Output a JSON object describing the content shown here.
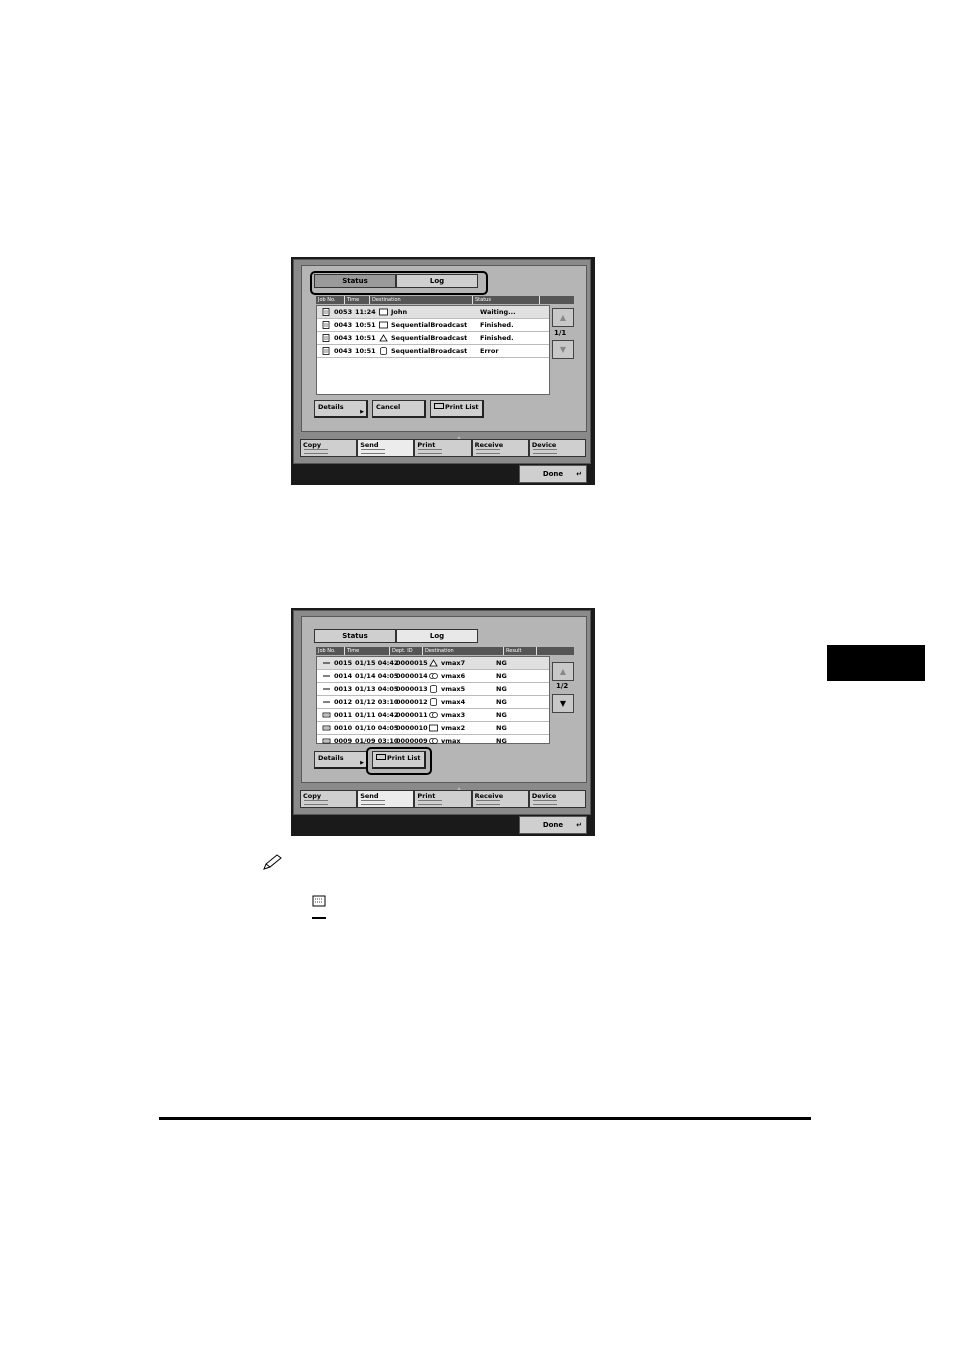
{
  "screen1": {
    "tabs": [
      "Status",
      "Log"
    ],
    "columns": [
      "Job No.",
      "Time",
      "Destination",
      "Status"
    ],
    "rows": [
      {
        "job": "0053",
        "time": "11:24",
        "dest_icon": "pc-icon",
        "dest": "John",
        "status": "Waiting..."
      },
      {
        "job": "0043",
        "time": "10:51",
        "dest_icon": "pc-icon",
        "dest": "SequentialBroadcast",
        "status": "Finished."
      },
      {
        "job": "0043",
        "time": "10:51",
        "dest_icon": "fax-icon",
        "dest": "SequentialBroadcast",
        "status": "Finished."
      },
      {
        "job": "0043",
        "time": "10:51",
        "dest_icon": "database-icon",
        "dest": "SequentialBroadcast",
        "status": "Error"
      }
    ],
    "page": "1/1",
    "buttons": {
      "details": "Details",
      "cancel": "Cancel",
      "print_list": "Print List"
    },
    "func_tabs": [
      "Copy",
      "Send",
      "Print",
      "Receive",
      "Device"
    ],
    "done": "Done"
  },
  "screen2": {
    "tabs": [
      "Status",
      "Log"
    ],
    "columns": [
      "Job No.",
      "Time",
      "Dept. ID",
      "Destination",
      "Result"
    ],
    "rows": [
      {
        "job": "0015",
        "time": "01/15 04:42",
        "dept": "0000015",
        "dest_icon": "fax-icon",
        "dest": "vmax7",
        "result": "NG"
      },
      {
        "job": "0014",
        "time": "01/14 04:05",
        "dept": "0000014",
        "dest_icon": "group-icon",
        "dest": "vmax6",
        "result": "NG"
      },
      {
        "job": "0013",
        "time": "01/13 04:05",
        "dept": "0000013",
        "dest_icon": "database-icon",
        "dest": "vmax5",
        "result": "NG"
      },
      {
        "job": "0012",
        "time": "01/12 03:10",
        "dept": "0000012",
        "dest_icon": "database-icon",
        "dest": "vmax4",
        "result": "NG"
      },
      {
        "job": "0011",
        "time": "01/11 04:42",
        "dept": "0000011",
        "dest_icon": "group-icon",
        "dest": "vmax3",
        "result": "NG"
      },
      {
        "job": "0010",
        "time": "01/10 04:05",
        "dept": "0000010",
        "dest_icon": "pc-icon",
        "dest": "vmax2",
        "result": "NG"
      },
      {
        "job": "0009",
        "time": "01/09 03:10",
        "dept": "0000009",
        "dest_icon": "group-icon",
        "dest": "vmax",
        "result": "NG"
      }
    ],
    "page": "1/2",
    "buttons": {
      "details": "Details",
      "print_list": "Print List"
    },
    "func_tabs": [
      "Copy",
      "Send",
      "Print",
      "Receive",
      "Device"
    ],
    "done": "Done"
  },
  "colors": {
    "panel_bg": "#8a8a8a",
    "screen_bg": "#b5b5b5",
    "frame": "#1a1a1a",
    "sidetab": "#000000"
  }
}
